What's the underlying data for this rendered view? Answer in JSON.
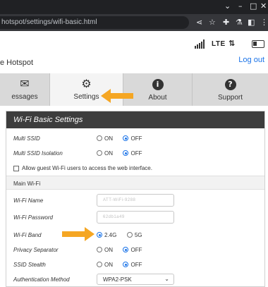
{
  "browser": {
    "url_text": "hotspot/settings/wifi-basic.html",
    "window_controls": [
      "⌄",
      "–",
      "□",
      "✕"
    ],
    "toolbar_icons": [
      "share-icon",
      "star-icon",
      "extensions-icon",
      "lab-icon",
      "sidebar-icon",
      "menu-icon"
    ]
  },
  "header": {
    "brand": "e Hotspot",
    "logout": "Log out",
    "network_type": "LTE"
  },
  "tabs": [
    {
      "label": "essages",
      "icon": "envelope-icon",
      "active": false
    },
    {
      "label": "Settings",
      "icon": "gear-icon",
      "active": true
    },
    {
      "label": "About",
      "icon": "info-icon",
      "active": false
    },
    {
      "label": "Support",
      "icon": "help-icon",
      "active": false
    }
  ],
  "panel": {
    "title": "Wi-Fi Basic Settings",
    "multi_ssid": {
      "label": "Multi SSID",
      "on": "ON",
      "off": "OFF",
      "selected": "OFF"
    },
    "multi_ssid_isolation": {
      "label": "Multi SSID Isolation",
      "on": "ON",
      "off": "OFF",
      "selected": "OFF"
    },
    "guest_access": {
      "label": "Allow guest Wi-Fi users to access the web interface.",
      "checked": false
    },
    "main_wifi_heading": "Main Wi-Fi",
    "wifi_name": {
      "label": "Wi-Fi Name",
      "value": "ATT-WiFi-9288"
    },
    "wifi_password": {
      "label": "Wi-Fi Password",
      "value": "62db1a49"
    },
    "wifi_band": {
      "label": "Wi-Fi Band",
      "option_a": "2.4G",
      "option_b": "5G",
      "selected": "2.4G"
    },
    "privacy_separator": {
      "label": "Privacy Separator",
      "on": "ON",
      "off": "OFF",
      "selected": "OFF"
    },
    "ssid_stealth": {
      "label": "SSID Stealth",
      "on": "ON",
      "off": "OFF",
      "selected": "OFF"
    },
    "auth_method": {
      "label": "Authentication Method",
      "value": "WPA2-PSK"
    }
  },
  "colors": {
    "accent": "#1a73e8",
    "annotation_arrow": "#f5a623",
    "panel_header": "#3d3d3d"
  }
}
